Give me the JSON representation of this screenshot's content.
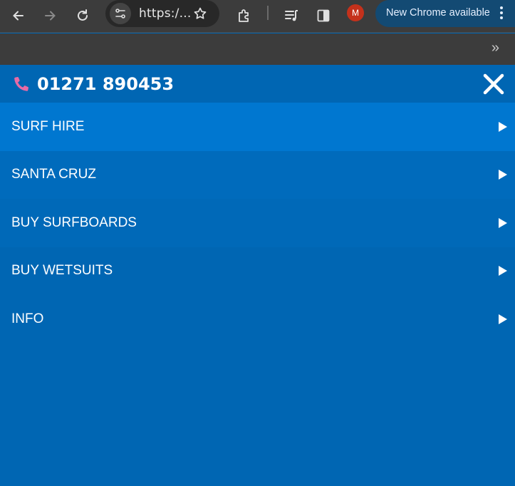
{
  "browser": {
    "url_display": "https:/...",
    "avatar_letter": "M",
    "update_label": "New Chrome available"
  },
  "header": {
    "phone": "01271 890453",
    "phone_icon_color": "#e86aa5"
  },
  "menu": {
    "items": [
      {
        "label": "SURF HIRE"
      },
      {
        "label": "SANTA CRUZ"
      },
      {
        "label": "BUY SURFBOARDS"
      },
      {
        "label": "BUY WETSUITS"
      },
      {
        "label": "INFO"
      }
    ]
  },
  "colors": {
    "background": "#0066b3",
    "active_item": "#0077d0"
  }
}
